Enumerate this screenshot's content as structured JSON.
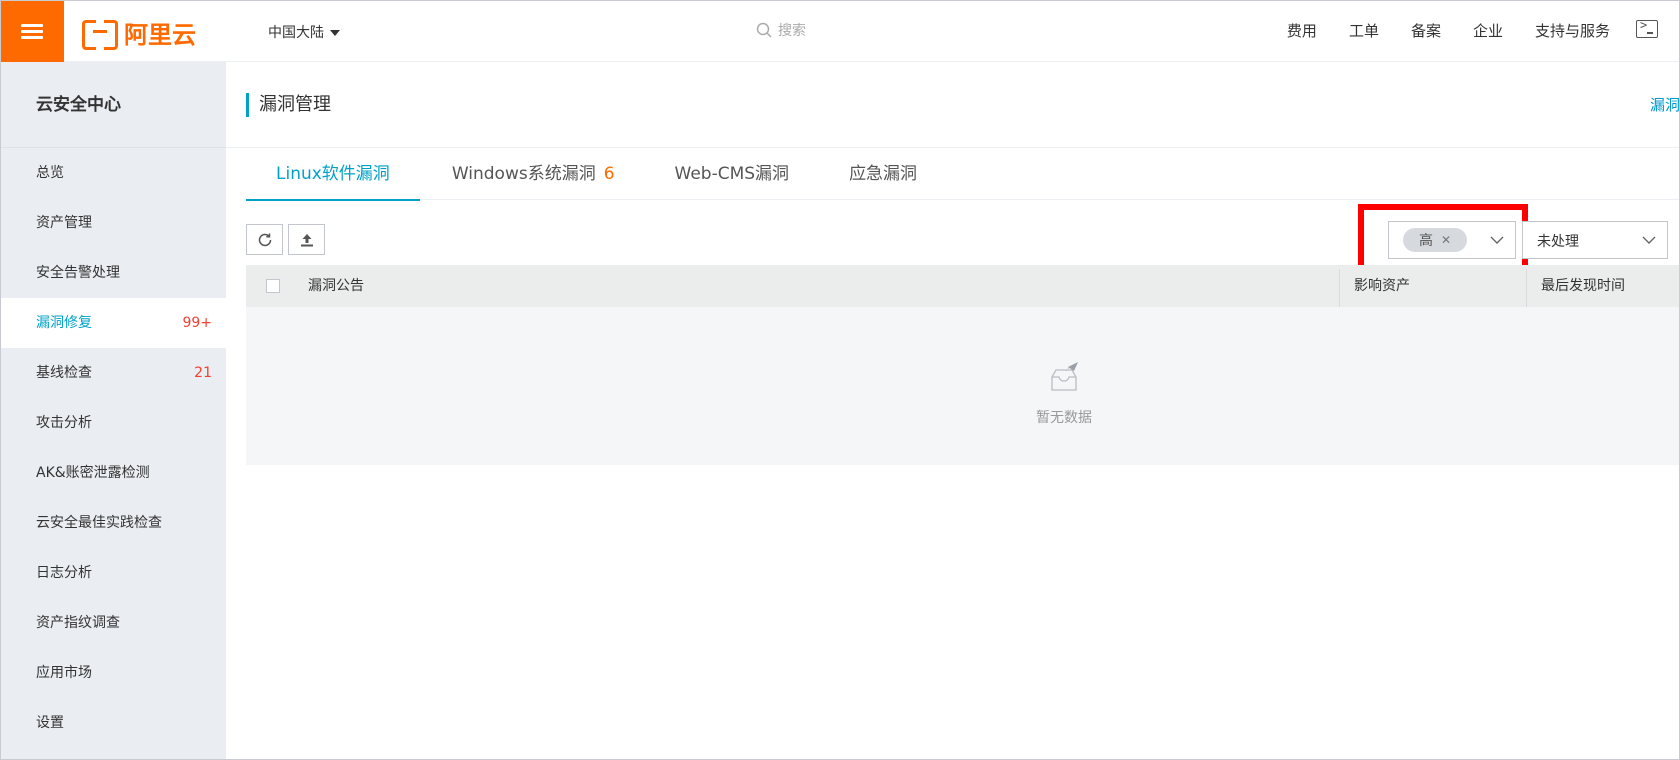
{
  "topbar": {
    "brand": "阿里云",
    "region": "中国大陆",
    "search_placeholder": "搜索",
    "links": [
      "费用",
      "工单",
      "备案",
      "企业",
      "支持与服务"
    ],
    "brand_color": "#ff6a00"
  },
  "sidebar": {
    "title": "云安全中心",
    "items": [
      {
        "label": "总览"
      },
      {
        "label": "资产管理"
      },
      {
        "label": "安全告警处理"
      },
      {
        "label": "漏洞修复",
        "badge": "99+",
        "active": true
      },
      {
        "label": "基线检查",
        "badge": "21"
      },
      {
        "label": "攻击分析"
      },
      {
        "label": "AK&账密泄露检测"
      },
      {
        "label": "云安全最佳实践检查"
      },
      {
        "label": "日志分析"
      },
      {
        "label": "资产指纹调查"
      },
      {
        "label": "应用市场"
      },
      {
        "label": "设置"
      }
    ]
  },
  "page": {
    "title": "漏洞管理",
    "head_link": "漏洞修"
  },
  "tabs": [
    {
      "label": "Linux软件漏洞",
      "active": true
    },
    {
      "label": "Windows系统漏洞",
      "count": "6"
    },
    {
      "label": "Web-CMS漏洞"
    },
    {
      "label": "应急漏洞"
    }
  ],
  "filters": {
    "level_tag": "高",
    "status_value": "未处理"
  },
  "table": {
    "columns": [
      "漏洞公告",
      "影响资产",
      "最后发现时间"
    ],
    "empty_text": "暂无数据"
  },
  "colors": {
    "accent": "#00a2ca",
    "highlight_frame": "#ff0000",
    "badge": "#f04134"
  }
}
